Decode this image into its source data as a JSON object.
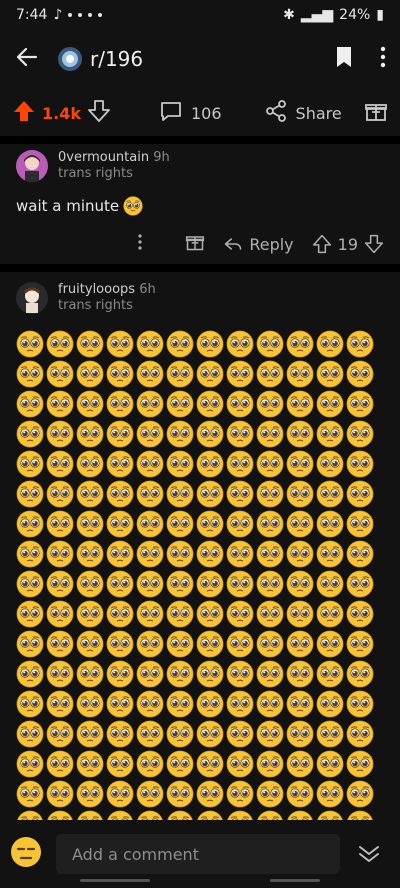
{
  "status": {
    "time": "7:44",
    "battery": "24%"
  },
  "nav": {
    "subreddit": "r/196",
    "back_icon": "back-arrow-icon",
    "bookmark_icon": "bookmark-icon",
    "more_icon": "more-vertical-icon"
  },
  "post_actions": {
    "upvotes": "1.4k",
    "comments": "106",
    "share_label": "Share",
    "accent": "#ff4500"
  },
  "comments": [
    {
      "author": "0vermountain",
      "time": "9h",
      "flair": "trans rights",
      "body": "wait a minute",
      "reply_label": "Reply",
      "score": "19"
    },
    {
      "author": "fruitylooops",
      "time": "6h",
      "flair": "trans rights",
      "emoji_rows": 17,
      "emoji_cols": 12
    }
  ],
  "composer": {
    "placeholder": "Add a comment"
  }
}
